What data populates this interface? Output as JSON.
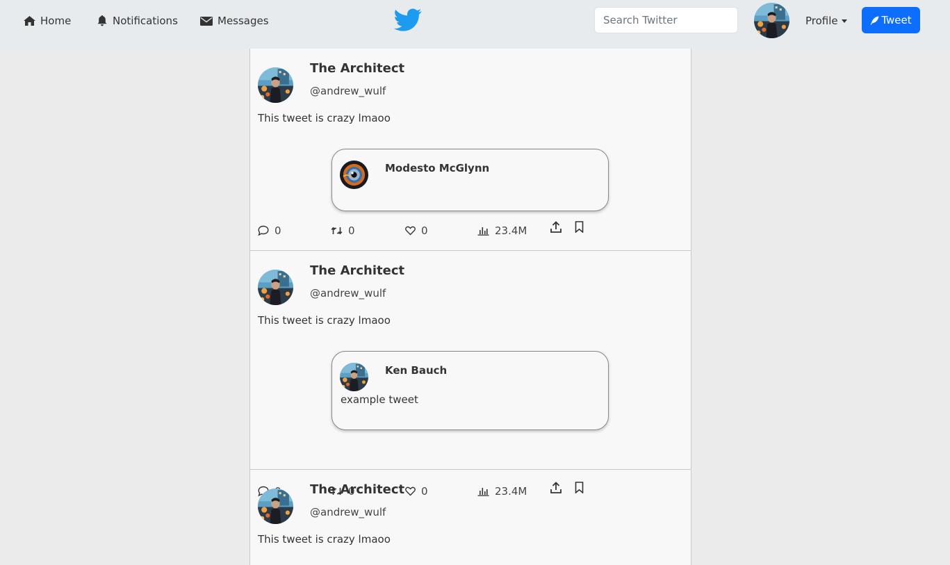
{
  "nav": {
    "home_label": "Home",
    "notifications_label": "Notifications",
    "messages_label": "Messages",
    "search_placeholder": "Search Twitter",
    "profile_label": "Profile",
    "tweet_button_label": "Tweet",
    "brand_icon": "twitter-bird-icon",
    "brand_color": "#1d9bf0",
    "accent_color": "#0d6efd"
  },
  "tweets": [
    {
      "name": "The Architect",
      "handle": "@andrew_wulf",
      "text": "This tweet is crazy lmaoo",
      "quote": {
        "name": "Modesto McGlynn",
        "text": ""
      },
      "stats": {
        "replies": "0",
        "retweets": "0",
        "likes": "0",
        "views": "23.4M"
      }
    },
    {
      "name": "The Architect",
      "handle": "@andrew_wulf",
      "text": "This tweet is crazy lmaoo",
      "quote": {
        "name": "Ken Bauch",
        "text": "example tweet"
      },
      "stats": {
        "replies": "0",
        "retweets": "0",
        "likes": "0",
        "views": "23.4M"
      }
    },
    {
      "name": "The Architect",
      "handle": "@andrew_wulf",
      "text": "This tweet is crazy lmaoo"
    }
  ]
}
